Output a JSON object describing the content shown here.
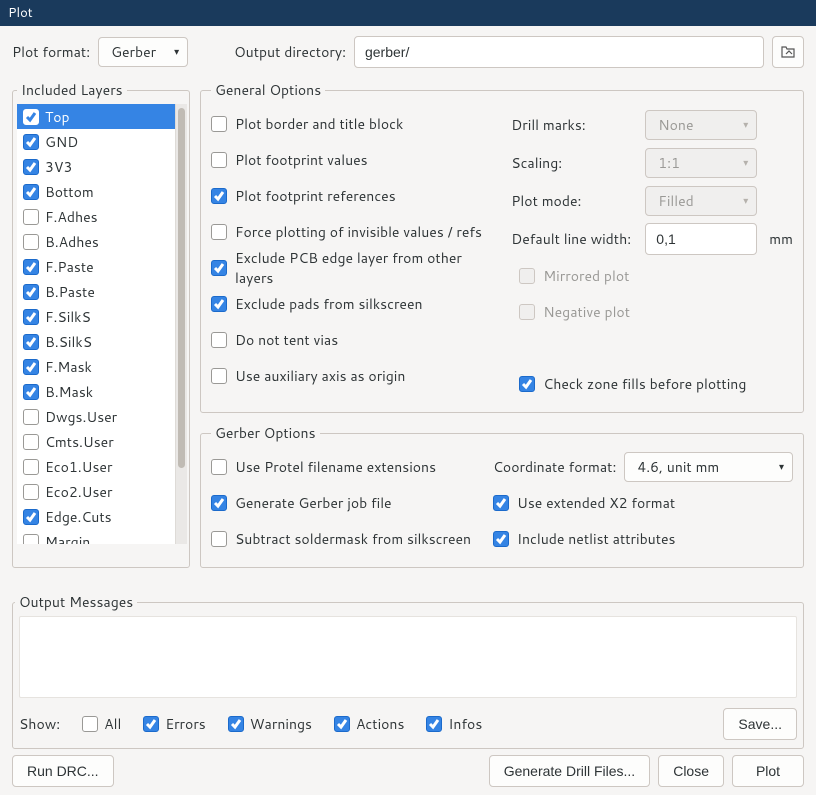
{
  "window": {
    "title": "Plot"
  },
  "top": {
    "plot_format_label": "Plot format:",
    "plot_format_value": "Gerber",
    "output_dir_label": "Output directory:",
    "output_dir_value": "gerber/"
  },
  "layers_legend": "Included Layers",
  "layers": [
    {
      "label": "Top",
      "checked": true,
      "selected": true
    },
    {
      "label": "GND",
      "checked": true
    },
    {
      "label": "3V3",
      "checked": true
    },
    {
      "label": "Bottom",
      "checked": true
    },
    {
      "label": "F.Adhes",
      "checked": false
    },
    {
      "label": "B.Adhes",
      "checked": false
    },
    {
      "label": "F.Paste",
      "checked": true
    },
    {
      "label": "B.Paste",
      "checked": true
    },
    {
      "label": "F.SilkS",
      "checked": true
    },
    {
      "label": "B.SilkS",
      "checked": true
    },
    {
      "label": "F.Mask",
      "checked": true
    },
    {
      "label": "B.Mask",
      "checked": true
    },
    {
      "label": "Dwgs.User",
      "checked": false
    },
    {
      "label": "Cmts.User",
      "checked": false
    },
    {
      "label": "Eco1.User",
      "checked": false
    },
    {
      "label": "Eco2.User",
      "checked": false
    },
    {
      "label": "Edge.Cuts",
      "checked": true
    },
    {
      "label": "Margin",
      "checked": false
    }
  ],
  "general_legend": "General Options",
  "general_left": [
    {
      "label": "Plot border and title block",
      "checked": false
    },
    {
      "label": "Plot footprint values",
      "checked": false
    },
    {
      "label": "Plot footprint references",
      "checked": true
    },
    {
      "label": "Force plotting of invisible values / refs",
      "checked": false
    },
    {
      "label": "Exclude PCB edge layer from other layers",
      "checked": true
    },
    {
      "label": "Exclude pads from silkscreen",
      "checked": true
    },
    {
      "label": "Do not tent vias",
      "checked": false
    },
    {
      "label": "Use auxiliary axis as origin",
      "checked": false
    }
  ],
  "general_right_top": {
    "drill_label": "Drill marks:",
    "drill_value": "None",
    "scaling_label": "Scaling:",
    "scaling_value": "1:1",
    "mode_label": "Plot mode:",
    "mode_value": "Filled",
    "linewidth_label": "Default line width:",
    "linewidth_value": "0,1",
    "linewidth_unit": "mm"
  },
  "general_right_checks": [
    {
      "label": "Mirrored plot",
      "checked": false,
      "disabled": true
    },
    {
      "label": "Negative plot",
      "checked": false,
      "disabled": true
    },
    {
      "label": "Check zone fills before plotting",
      "checked": true
    }
  ],
  "gerber_legend": "Gerber Options",
  "gerber_left": [
    {
      "label": "Use Protel filename extensions",
      "checked": false
    },
    {
      "label": "Generate Gerber job file",
      "checked": true
    },
    {
      "label": "Subtract soldermask from silkscreen",
      "checked": false
    }
  ],
  "gerber_right": [
    {
      "label": "Use extended X2 format",
      "checked": true
    },
    {
      "label": "Include netlist attributes",
      "checked": true
    }
  ],
  "gerber_coord": {
    "label": "Coordinate format:",
    "value": "4.6, unit mm"
  },
  "outmsg_legend": "Output Messages",
  "show": {
    "label": "Show:",
    "all": "All",
    "errors": "Errors",
    "warnings": "Warnings",
    "actions": "Actions",
    "infos": "Infos",
    "all_checked": false,
    "errors_checked": true,
    "warnings_checked": true,
    "actions_checked": true,
    "infos_checked": true
  },
  "buttons": {
    "save": "Save...",
    "rundrc": "Run DRC...",
    "gen": "Generate Drill Files...",
    "close": "Close",
    "plot": "Plot"
  }
}
